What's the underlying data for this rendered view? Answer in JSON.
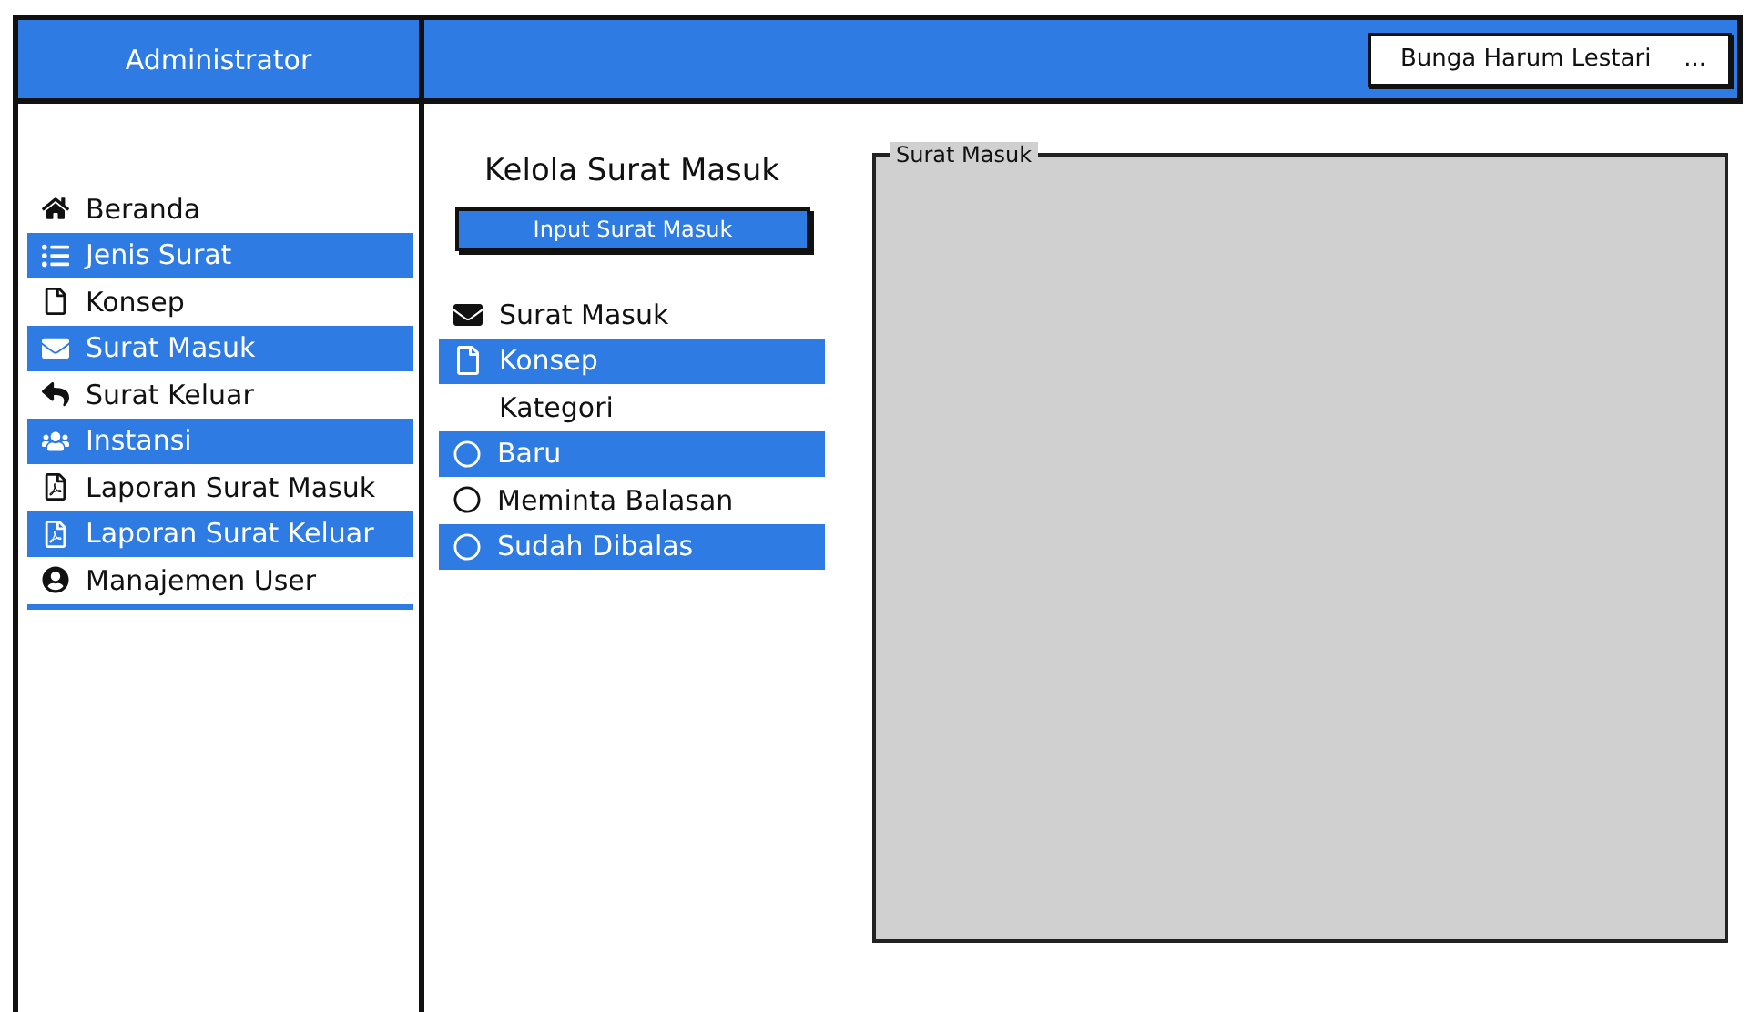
{
  "header": {
    "title": "Administrator",
    "user_button": {
      "label": "Bunga Harum Lestari",
      "menu": "..."
    }
  },
  "sidebar": {
    "items": [
      {
        "label": "Beranda",
        "highlighted": false
      },
      {
        "label": "Jenis Surat",
        "highlighted": true
      },
      {
        "label": "Konsep",
        "highlighted": false
      },
      {
        "label": "Surat Masuk",
        "highlighted": true
      },
      {
        "label": "Surat Keluar",
        "highlighted": false
      },
      {
        "label": "Instansi",
        "highlighted": true
      },
      {
        "label": "Laporan Surat Masuk",
        "highlighted": false
      },
      {
        "label": "Laporan Surat Keluar",
        "highlighted": true
      },
      {
        "label": "Manajemen User",
        "highlighted": false
      }
    ]
  },
  "content": {
    "title": "Kelola Surat Masuk",
    "input_button": "Input Surat Masuk",
    "menu": [
      {
        "label": "Surat Masuk",
        "kind": "icon",
        "highlighted": false
      },
      {
        "label": "Konsep",
        "kind": "icon",
        "highlighted": true
      },
      {
        "label": "Kategori",
        "kind": "plain",
        "highlighted": false
      },
      {
        "label": "Baru",
        "kind": "radio",
        "highlighted": true
      },
      {
        "label": "Meminta Balasan",
        "kind": "radio",
        "highlighted": false
      },
      {
        "label": "Sudah Dibalas",
        "kind": "radio",
        "highlighted": true
      }
    ],
    "panel": {
      "legend": "Surat Masuk"
    }
  }
}
